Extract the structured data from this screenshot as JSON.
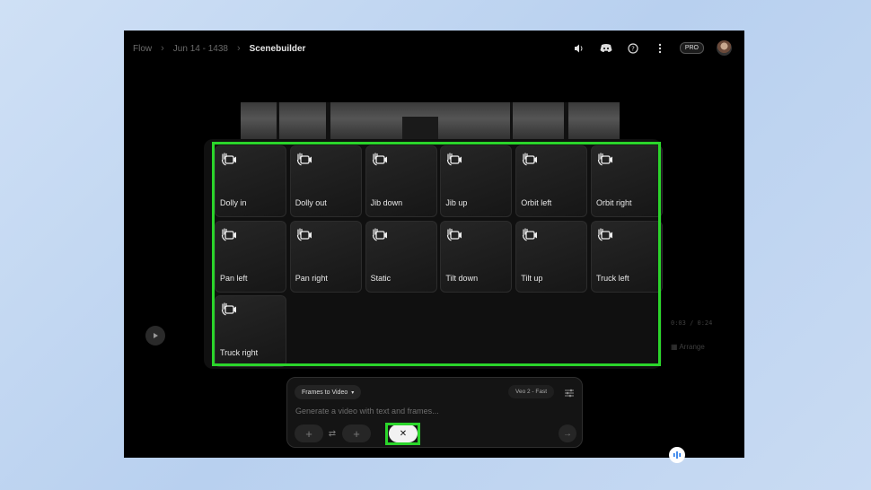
{
  "breadcrumb": {
    "items": [
      "Flow",
      "Jun 14 - 1438"
    ],
    "current": "Scenebuilder"
  },
  "header": {
    "pro_badge": "PRO"
  },
  "background": {
    "timecode": "0:03 / 0:24",
    "arrange_label": "Arrange"
  },
  "camera_motions": {
    "items": [
      {
        "label": "Dolly in"
      },
      {
        "label": "Dolly out"
      },
      {
        "label": "Jib down"
      },
      {
        "label": "Jib up"
      },
      {
        "label": "Orbit left"
      },
      {
        "label": "Orbit right"
      },
      {
        "label": "Pan left"
      },
      {
        "label": "Pan right"
      },
      {
        "label": "Static"
      },
      {
        "label": "Tilt down"
      },
      {
        "label": "Tilt up"
      },
      {
        "label": "Truck left"
      },
      {
        "label": "Truck right"
      }
    ],
    "icon": "camera-hand-icon"
  },
  "prompt": {
    "mode_label": "Frames to Video",
    "model_label": "Veo 2 - Fast",
    "placeholder": "Generate a video with text and frames..."
  },
  "colors": {
    "highlight": "#2bd52b",
    "app_bg": "#000000",
    "page_bg": "#c4d9f2"
  }
}
